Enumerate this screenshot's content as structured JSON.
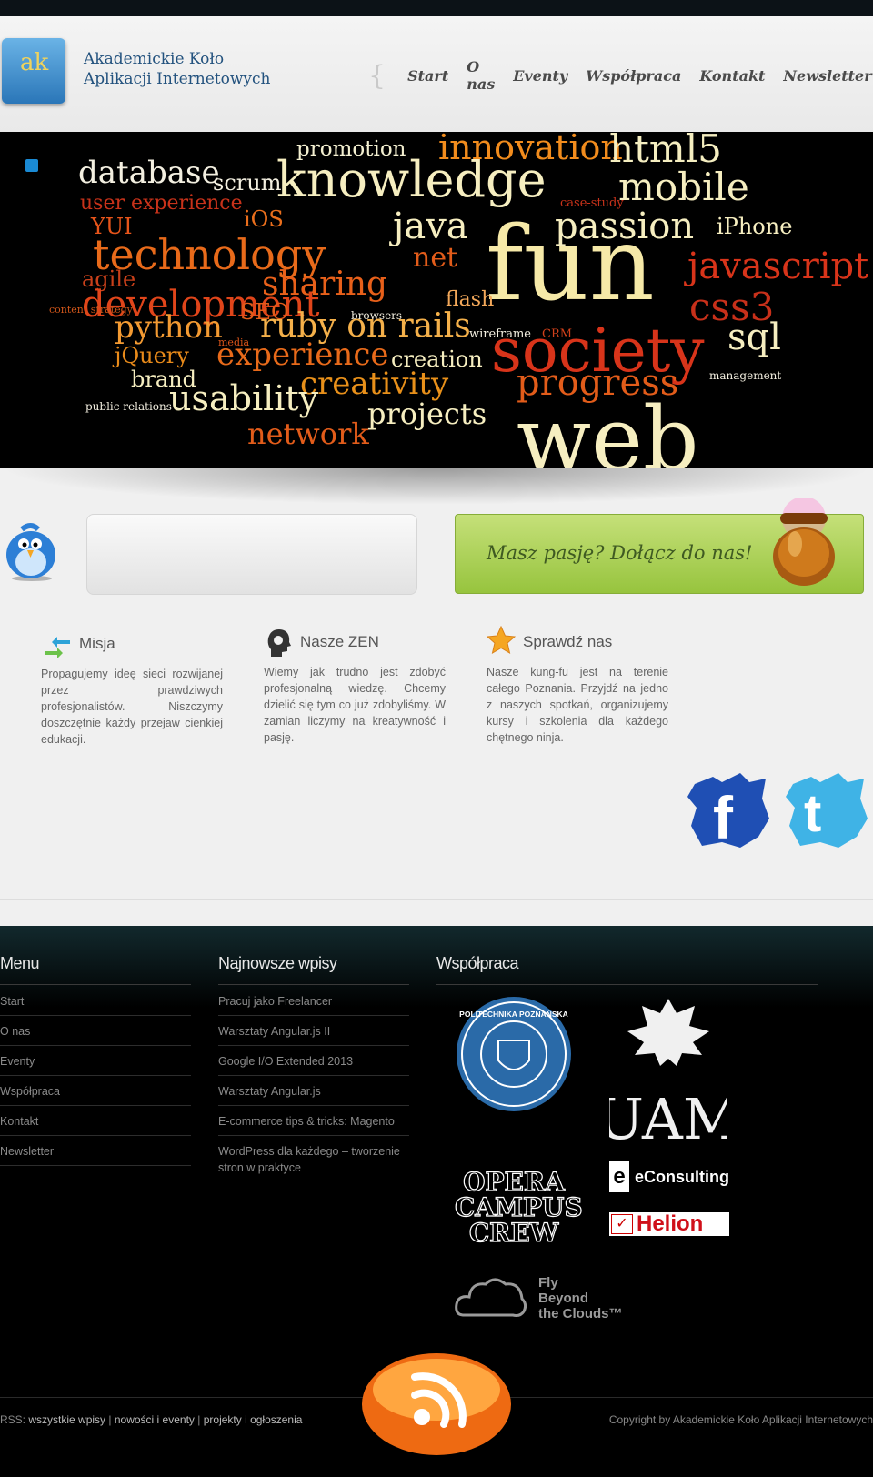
{
  "header": {
    "logo_text": "ak",
    "brand_line1": "Akademickie Koło",
    "brand_line2": "Aplikacji Internetowych",
    "brace_open": "{",
    "brace_close": "}",
    "nav": [
      "Start",
      "O nas",
      "Eventy",
      "Współpraca",
      "Kontakt",
      "Newsletter"
    ]
  },
  "hero_words": [
    "promotion",
    "innovation",
    "html5",
    "database",
    "scrum",
    "knowledge",
    "mobile",
    "user experience",
    "case-study",
    "YUI",
    "iOS",
    "java",
    "passion",
    "iPhone",
    "technology",
    "net",
    "fun",
    "javascript",
    "agile",
    "sharing",
    "development",
    "content strategy",
    "SEO",
    "flash",
    "css3",
    "python",
    "ruby on rails",
    "browsers",
    "wireframe",
    "CRM",
    "sql",
    "media",
    "jQuery",
    "experience",
    "creation",
    "society",
    "brand",
    "creativity",
    "progress",
    "management",
    "public relations",
    "usability",
    "projects",
    "network",
    "web"
  ],
  "join": {
    "label": "Masz pasję? Dołącz do nas!"
  },
  "columns": [
    {
      "title": "Misja",
      "icon": "exchange-arrows-icon",
      "text": "Propagujemy ideę sieci rozwijanej przez prawdziwych profesjonalistów. Niszczymy doszczętnie każdy przejaw cienkiej edukacji."
    },
    {
      "title": "Nasze ZEN",
      "icon": "head-profile-icon",
      "text": "Wiemy jak trudno jest zdobyć profesjonalną wiedzę. Chcemy dzielić się tym co już zdobyliśmy. W zamian liczymy na kreatywność i pasję."
    },
    {
      "title": "Sprawdź nas",
      "icon": "star-icon",
      "text": "Nasze kung-fu jest na terenie całego Poznania. Przyjdź na jedno z naszych spotkań, organizujemy kursy i szkolenia dla każdego chętnego ninja."
    }
  ],
  "social": {
    "facebook": "f",
    "twitter": "t"
  },
  "footer": {
    "menu_title": "Menu",
    "menu": [
      "Start",
      "O nas",
      "Eventy",
      "Współpraca",
      "Kontakt",
      "Newsletter"
    ],
    "posts_title": "Najnowsze wpisy",
    "posts": [
      "Pracuj jako Freelancer",
      "Warsztaty Angular.js II",
      "Google I/O Extended 2013",
      "Warsztaty Angular.js",
      "E-commerce tips & tricks: Magento",
      "WordPress dla każdego – tworzenie stron w praktyce"
    ],
    "partners_title": "Współpraca",
    "partners": {
      "pp": "POLITECHNIKA POZNAŃSKA",
      "uam": "UAM",
      "opera": [
        "OPERA",
        "CAMPUS",
        "CREW"
      ],
      "econsulting": "eConsulting",
      "helion": "Helion",
      "fly": [
        "Fly",
        "Beyond",
        "the Clouds™"
      ]
    }
  },
  "bottom": {
    "rss_prefix": "RSS:",
    "rss_links": [
      "wszystkie wpisy",
      "nowości i eventy",
      "projekty i ogłoszenia"
    ],
    "separator": "|",
    "copyright": "Copyright by Akademickie Koło Aplikacji Internetowych"
  }
}
